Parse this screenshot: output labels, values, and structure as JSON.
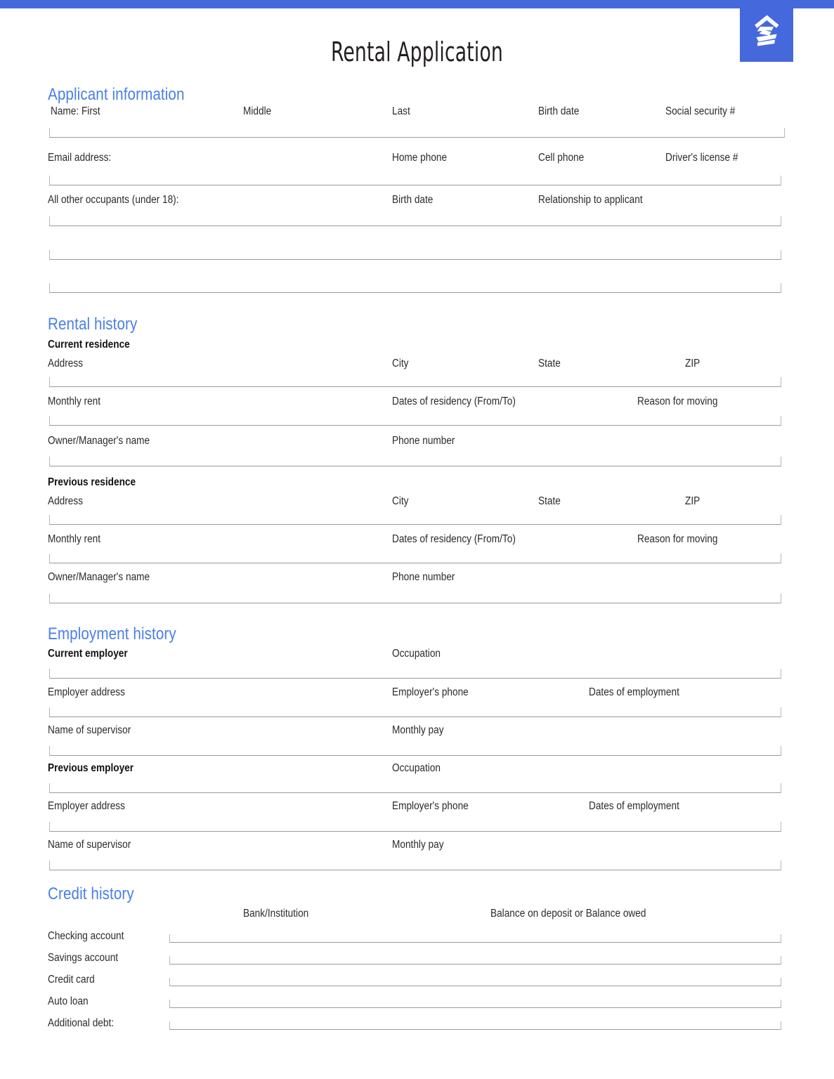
{
  "document": {
    "title": "Rental Application",
    "brand_logo": "zillow-logo",
    "accent_color": "#4668dd",
    "heading_color": "#4a7fe8"
  },
  "sections": {
    "applicant": {
      "heading": "Applicant information",
      "name_row": {
        "first": "Name: First",
        "middle": "Middle",
        "last": "Last",
        "birth_date": "Birth date",
        "ssn": "Social security #"
      },
      "contact_row": {
        "email": "Email address:",
        "home_phone": "Home phone",
        "cell_phone": "Cell phone",
        "drivers_license": "Driver's license #"
      },
      "occupants_row": {
        "occupants": "All other occupants (under 18):",
        "birth_date": "Birth date",
        "relationship": "Relationship to applicant"
      }
    },
    "rental_history": {
      "heading": "Rental history",
      "current": {
        "sub_heading": "Current residence",
        "address": "Address",
        "city": "City",
        "state": "State",
        "zip": "ZIP",
        "monthly_rent": "Monthly rent",
        "dates": "Dates of residency (From/To)",
        "reason": "Reason for moving",
        "owner": "Owner/Manager's name",
        "phone": "Phone number"
      },
      "previous": {
        "sub_heading": "Previous residence",
        "address": "Address",
        "city": "City",
        "state": "State",
        "zip": "ZIP",
        "monthly_rent": "Monthly rent",
        "dates": "Dates of residency (From/To)",
        "reason": "Reason for moving",
        "owner": "Owner/Manager's name",
        "phone": "Phone number"
      }
    },
    "employment_history": {
      "heading": "Employment history",
      "current": {
        "sub_heading": "Current employer",
        "occupation": "Occupation",
        "employer_address": "Employer address",
        "employer_phone": "Employer's phone",
        "dates": "Dates of employment",
        "supervisor": "Name of supervisor",
        "monthly_pay": "Monthly pay"
      },
      "previous": {
        "sub_heading": "Previous employer",
        "occupation": "Occupation",
        "employer_address": "Employer address",
        "employer_phone": "Employer's phone",
        "dates": "Dates of employment",
        "supervisor": "Name of supervisor",
        "monthly_pay": "Monthly pay"
      }
    },
    "credit_history": {
      "heading": "Credit history",
      "col_bank": "Bank/Institution",
      "col_balance": "Balance on deposit or Balance owed",
      "rows": [
        {
          "label": "Checking account"
        },
        {
          "label": "Savings account"
        },
        {
          "label": "Credit card"
        },
        {
          "label": "Auto loan"
        },
        {
          "label": "Additional debt:"
        }
      ]
    }
  }
}
